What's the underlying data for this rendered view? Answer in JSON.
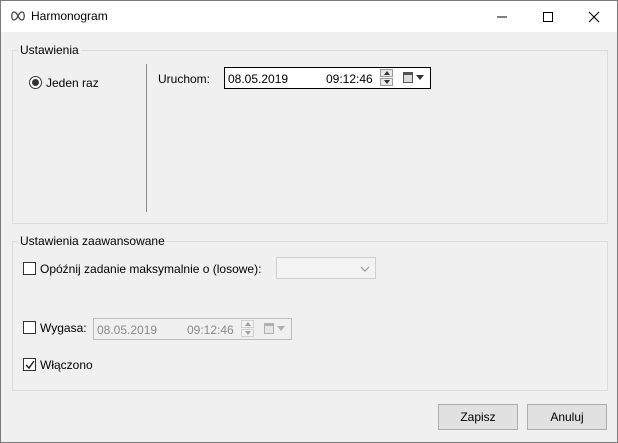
{
  "window": {
    "title": "Harmonogram",
    "icon": "infinity-icon",
    "controls": [
      "minimize-icon",
      "maximize-icon",
      "close-icon"
    ]
  },
  "settings": {
    "legend": "Ustawienia",
    "radio_label": "Jeden raz",
    "run_label": "Uruchom:",
    "run_date": "08.05.2019",
    "run_time": "09:12:46"
  },
  "advanced": {
    "legend": "Ustawienia zaawansowane",
    "delay_label": "Opóźnij zadanie maksymalnie o (losowe):",
    "delay_value": "",
    "delay_checked": false,
    "expire_label": "Wygasa:",
    "expire_checked": false,
    "expire_date": "08.05.2019",
    "expire_time": "09:12:46",
    "enabled_label": "Włączono",
    "enabled_checked": true
  },
  "buttons": {
    "save": "Zapisz",
    "cancel": "Anuluj"
  }
}
